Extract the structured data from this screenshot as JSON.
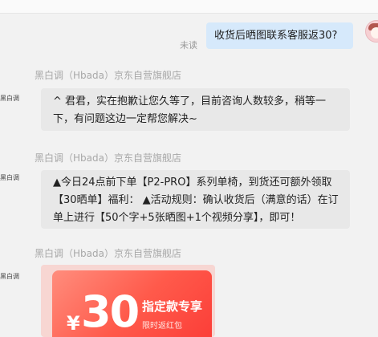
{
  "user_message": {
    "text": "收货后晒图联系客服返30?",
    "status": "未读"
  },
  "agent": {
    "avatar_label": "黑白调",
    "sender_name": "黑白调（Hbada）京东自营旗舰店"
  },
  "messages": [
    {
      "text": "^ 君君，实在抱歉让您久等了，目前咨询人数较多，稍等一下，有问题这边一定帮您解决~"
    },
    {
      "text": "▲今日24点前下单【P2-PRO】系列单椅，到货还可额外领取【30晒单】福利： ▲活动规则：确认收货后（满意的话）在订单上进行【50个字+5张晒图+1个视频分享】，即可！"
    }
  ],
  "coupon": {
    "currency": "¥",
    "amount": "30",
    "title": "指定款专享",
    "subtitle": "限时返红包"
  }
}
